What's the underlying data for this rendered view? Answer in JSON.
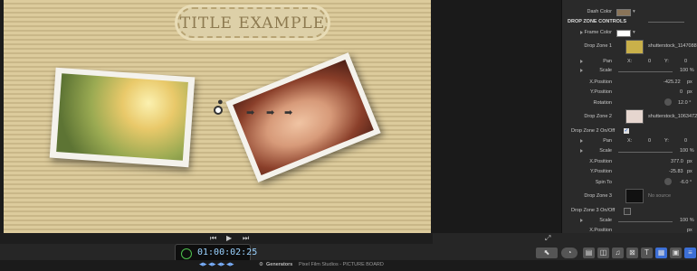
{
  "viewer": {
    "title": "TITLE EXAMPLE",
    "transport": {
      "prev": "⏮",
      "play": "▶",
      "next": "⏭"
    }
  },
  "inspector": {
    "dash_color_label": "Dash Color",
    "section_drop_zone_controls": "DROP ZONE CONTROLS",
    "frame_color_label": "Frame Color",
    "dz1": {
      "label": "Drop Zone 1",
      "file": "shutterstock_11470881"
    },
    "pan_label": "Pan",
    "x_label": "X:",
    "y_label": "Y:",
    "pan1_x": "0",
    "pan1_y": "0",
    "scale_label": "Scale",
    "scale1_val": "100 %",
    "xpos_label": "X.Position",
    "xpos1_val": "-425.22",
    "ypos_label": "Y.Position",
    "ypos1_val": "0",
    "px_unit": "px",
    "rotation_label": "Rotation",
    "rotation1_val": "12.0 °",
    "dz2": {
      "label": "Drop Zone 2",
      "file": "shutterstock_10634729"
    },
    "dz2_onoff_label": "Drop Zone 2 On/Off",
    "pan2_x": "0",
    "pan2_y": "0",
    "scale2_val": "100 %",
    "xpos2_val": "377.0",
    "ypos2_val": "-25.83",
    "spin_label": "Spin To",
    "spin_val": "-6.0 °",
    "dz3": {
      "label": "Drop Zone 3",
      "file": "No source"
    },
    "dz3_onoff_label": "Drop Zone 3 On/Off",
    "scale3_val": "100 %",
    "xpos3_label": "X.Position"
  },
  "bottom": {
    "timecode": "01:00:02:25",
    "generators_label": "Generators",
    "path_text": "Pixel Film Studios - PICTURE BOARD"
  },
  "colors": {
    "accent": "#9ad2ff",
    "canvas_stripe_a": "#dccb9c",
    "canvas_stripe_b": "#c9b788"
  }
}
